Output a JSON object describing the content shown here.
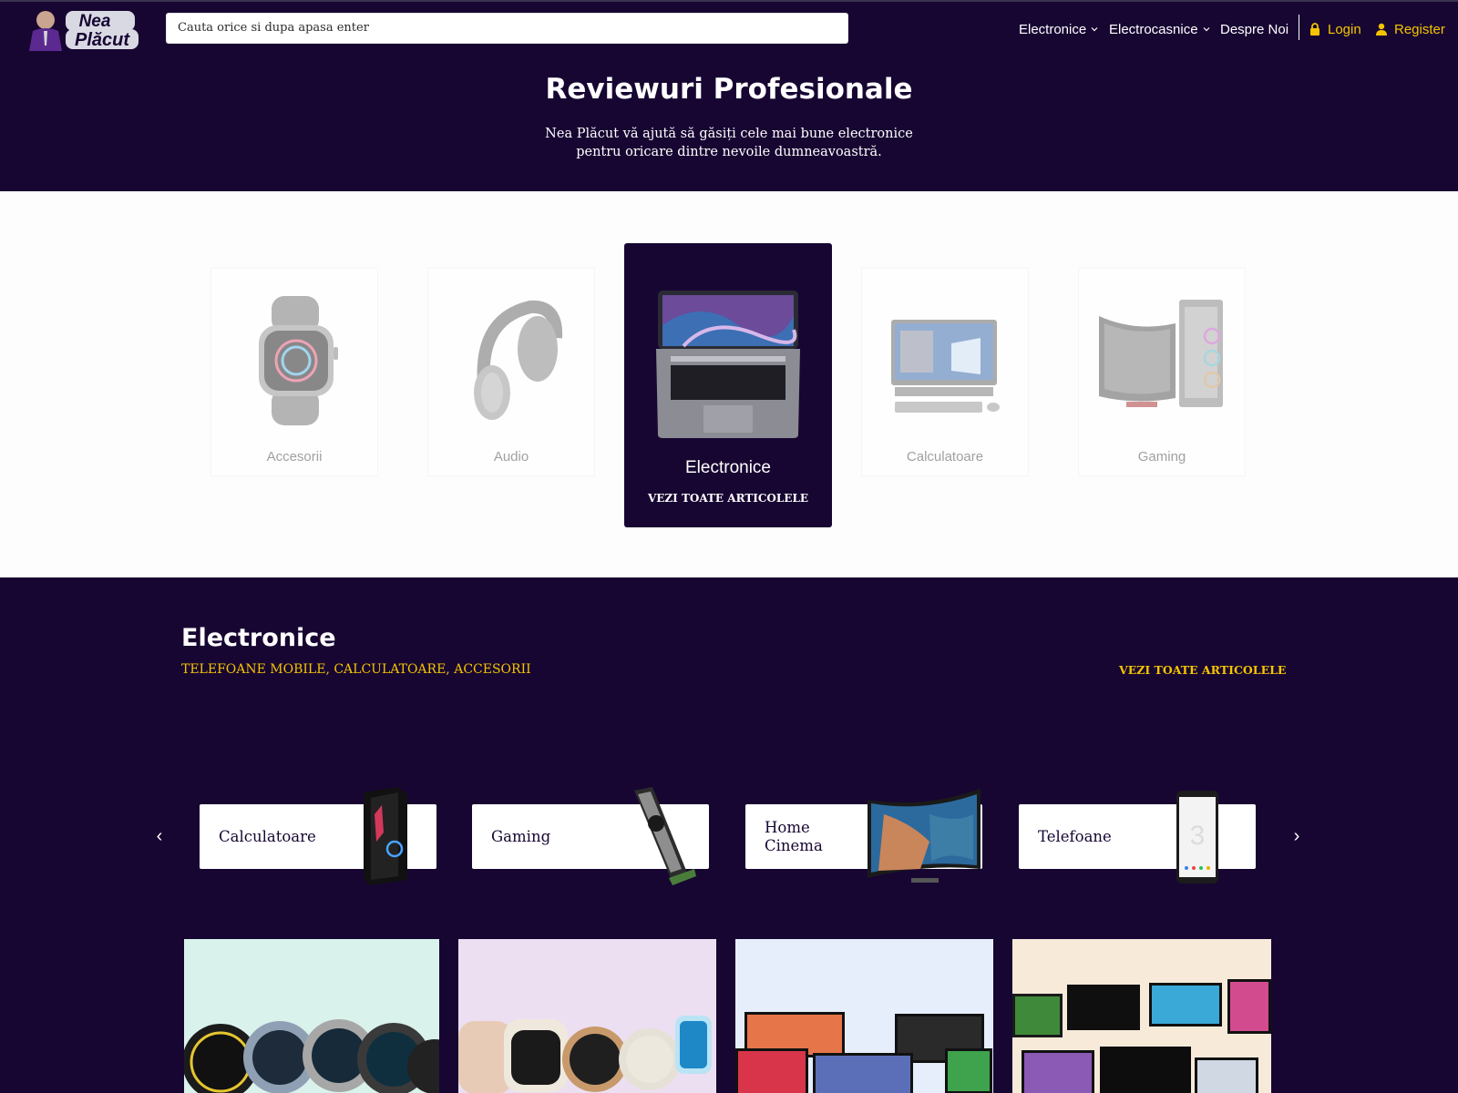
{
  "header": {
    "logo_text_line1": "Nea",
    "logo_text_line2": "Plăcut",
    "search_placeholder": "Cauta orice si dupa apasa enter",
    "nav": [
      "Electronice",
      "Electrocasnice",
      "Despre Noi"
    ],
    "login": "Login",
    "register": "Register"
  },
  "hero": {
    "title": "Reviewuri Profesionale",
    "subtitle": "Nea Plăcut vă ajută să găsiți cele mai bune electronice pentru oricare dintre nevoile dumneavoastră."
  },
  "categories": [
    {
      "label": "Accesorii",
      "icon": "smartwatch-icon"
    },
    {
      "label": "Audio",
      "icon": "headphones-icon"
    },
    {
      "label": "Electronice",
      "icon": "laptop-icon",
      "active": true,
      "more": "VEZI TOATE ARTICOLELE"
    },
    {
      "label": "Calculatoare",
      "icon": "desktop-computer-icon"
    },
    {
      "label": "Gaming",
      "icon": "gaming-pc-icon"
    }
  ],
  "section": {
    "title": "Electronice",
    "subtitle": "TELEFOANE MOBILE, CALCULATOARE, ACCESORII",
    "more": "VEZI TOATE ARTICOLELE",
    "subcategories": [
      {
        "label": "Calculatoare",
        "icon": "pc-tower-icon"
      },
      {
        "label": "Gaming",
        "icon": "graphics-card-icon"
      },
      {
        "label": "Home Cinema",
        "icon": "tv-icon"
      },
      {
        "label": "Telefoane",
        "icon": "smartphone-icon"
      }
    ],
    "prev_icon": "chevron-left-icon",
    "next_icon": "chevron-right-icon"
  },
  "tiles": [
    {
      "name": "smartwatches-tile",
      "bg": "#d9f2ec"
    },
    {
      "name": "watches-tile",
      "bg": "#ecdff2"
    },
    {
      "name": "tvs-tile",
      "bg": "#e6eefb"
    },
    {
      "name": "monitors-tile",
      "bg": "#f7ead9"
    }
  ],
  "colors": {
    "primary": "#170632",
    "accent": "#f5c400",
    "white": "#ffffff"
  }
}
